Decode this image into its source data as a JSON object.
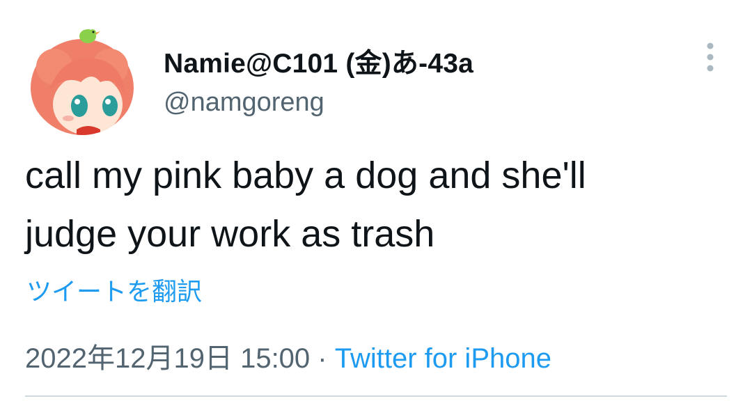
{
  "tweet": {
    "display_name": "Namie@C101 (金)あ-43a",
    "handle": "@namgoreng",
    "text": "call my pink baby a dog and she'll\njudge your work as trash",
    "translate_label": "ツイートを翻訳",
    "timestamp": "2022年12月19日 15:00",
    "separator": " · ",
    "source": "Twitter for iPhone",
    "more_icon": "vertical-ellipsis-icon",
    "avatar_description": "anime-girl-avatar"
  },
  "colors": {
    "text": "#0f1419",
    "secondary": "#536471",
    "link": "#1d9bf0",
    "divider": "#cfd9de",
    "more_icon": "#aab8c2"
  }
}
